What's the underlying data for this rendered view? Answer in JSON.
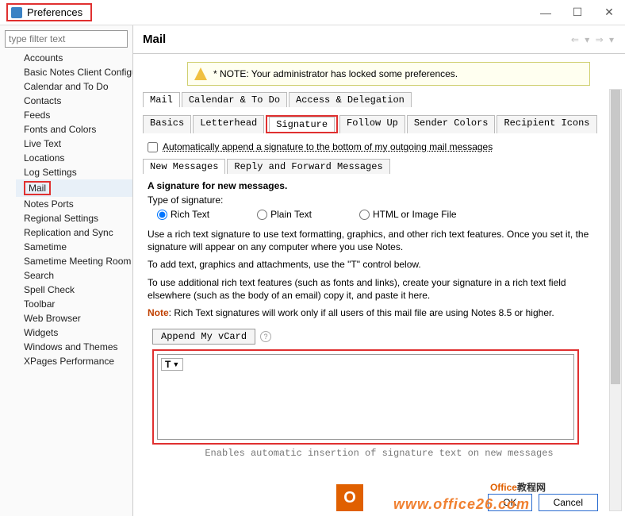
{
  "window": {
    "title": "Preferences"
  },
  "filter": {
    "placeholder": "type filter text"
  },
  "sidebar": {
    "items": [
      "Accounts",
      "Basic Notes Client Configu",
      "Calendar and To Do",
      "Contacts",
      "Feeds",
      "Fonts and Colors",
      "Live Text",
      "Locations",
      "Log Settings",
      "Mail",
      "Notes Ports",
      "Regional Settings",
      "Replication and Sync",
      "Sametime",
      "Sametime Meeting Room",
      "Search",
      "Spell Check",
      "Toolbar",
      "Web Browser",
      "Widgets",
      "Windows and Themes",
      "XPages Performance"
    ]
  },
  "page": {
    "title": "Mail"
  },
  "note": {
    "text": "* NOTE: Your administrator has locked some preferences."
  },
  "tabs1": [
    "Mail",
    "Calendar & To Do",
    "Access & Delegation"
  ],
  "tabs2": [
    "Basics",
    "Letterhead",
    "Signature",
    "Follow Up",
    "Sender Colors",
    "Recipient Icons"
  ],
  "tabs3": [
    "New Messages",
    "Reply and Forward Messages"
  ],
  "check": {
    "label": "Automatically append a signature to the bottom of my outgoing mail messages"
  },
  "sec": {
    "heading": "A signature for new messages.",
    "typelabel": "Type of signature:",
    "r1": "Rich Text",
    "r2": "Plain Text",
    "r3": "HTML or Image File",
    "p1": "Use a rich text signature to use text formatting, graphics, and other rich text features.  Once you set it, the signature will appear on any computer where you use Notes.",
    "p2": "To add text, graphics and attachments, use the \"T\" control below.",
    "p3": "To use additional rich text features (such as fonts and links), create your signature in a rich text field elsewhere (such as the body of an email) copy it, and paste it here.",
    "notelabel": "Note",
    "p4": ":  Rich Text signatures will work only if all users of this mail file are using Notes 8.5 or higher.",
    "append": "Append My vCard",
    "footertxt": "Enables automatic insertion of signature text on new messages"
  },
  "buttons": {
    "ok": "OK",
    "cancel": "Cancel"
  },
  "brand": {
    "name1": "Office",
    "name2": "教程网",
    "url": "www.office26.com"
  }
}
